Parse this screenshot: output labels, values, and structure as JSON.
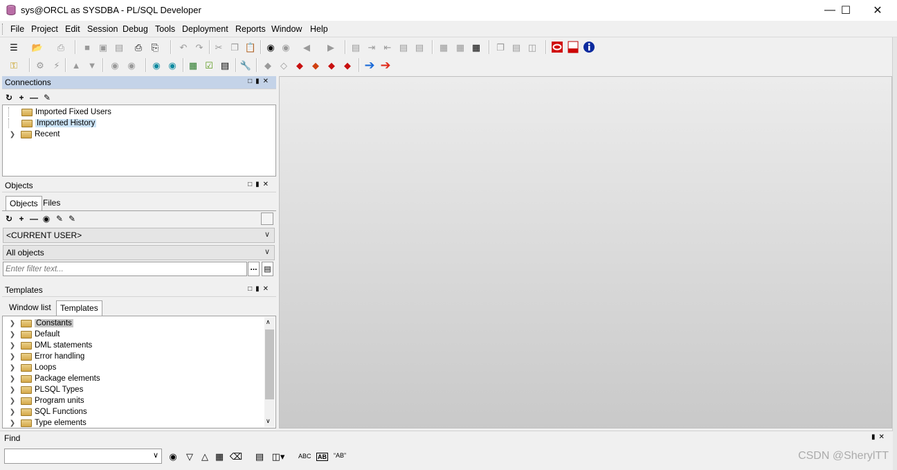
{
  "window": {
    "title": "sys@ORCL as SYSDBA - PL/SQL Developer",
    "controls": {
      "minimize": "—",
      "maximize": "☐",
      "close": "✕"
    }
  },
  "menu": [
    "File",
    "Project",
    "Edit",
    "Session",
    "Debug",
    "Tools",
    "Deployment",
    "Reports",
    "Window",
    "Help"
  ],
  "connections": {
    "title": "Connections",
    "items": [
      {
        "label": "Imported Fixed Users"
      },
      {
        "label": "Imported History"
      },
      {
        "label": "Recent"
      }
    ]
  },
  "objects": {
    "title": "Objects",
    "tabs": [
      "Objects",
      "Files"
    ],
    "user_select": "<CURRENT USER>",
    "filter_select": "All objects",
    "filter_placeholder": "Enter filter text...",
    "browse_label": "..."
  },
  "templates": {
    "title": "Templates",
    "tabs": [
      "Window list",
      "Templates"
    ],
    "items": [
      "Constants",
      "Default",
      "DML statements",
      "Error handling",
      "Loops",
      "Package elements",
      "PLSQL Types",
      "Program units",
      "SQL Functions",
      "Type elements"
    ]
  },
  "find": {
    "title": "Find",
    "abc_label": "ABC",
    "ab_label": "AB",
    "quoted_ab_label": "“AB”"
  },
  "watermark": "CSDN @SherylTT"
}
